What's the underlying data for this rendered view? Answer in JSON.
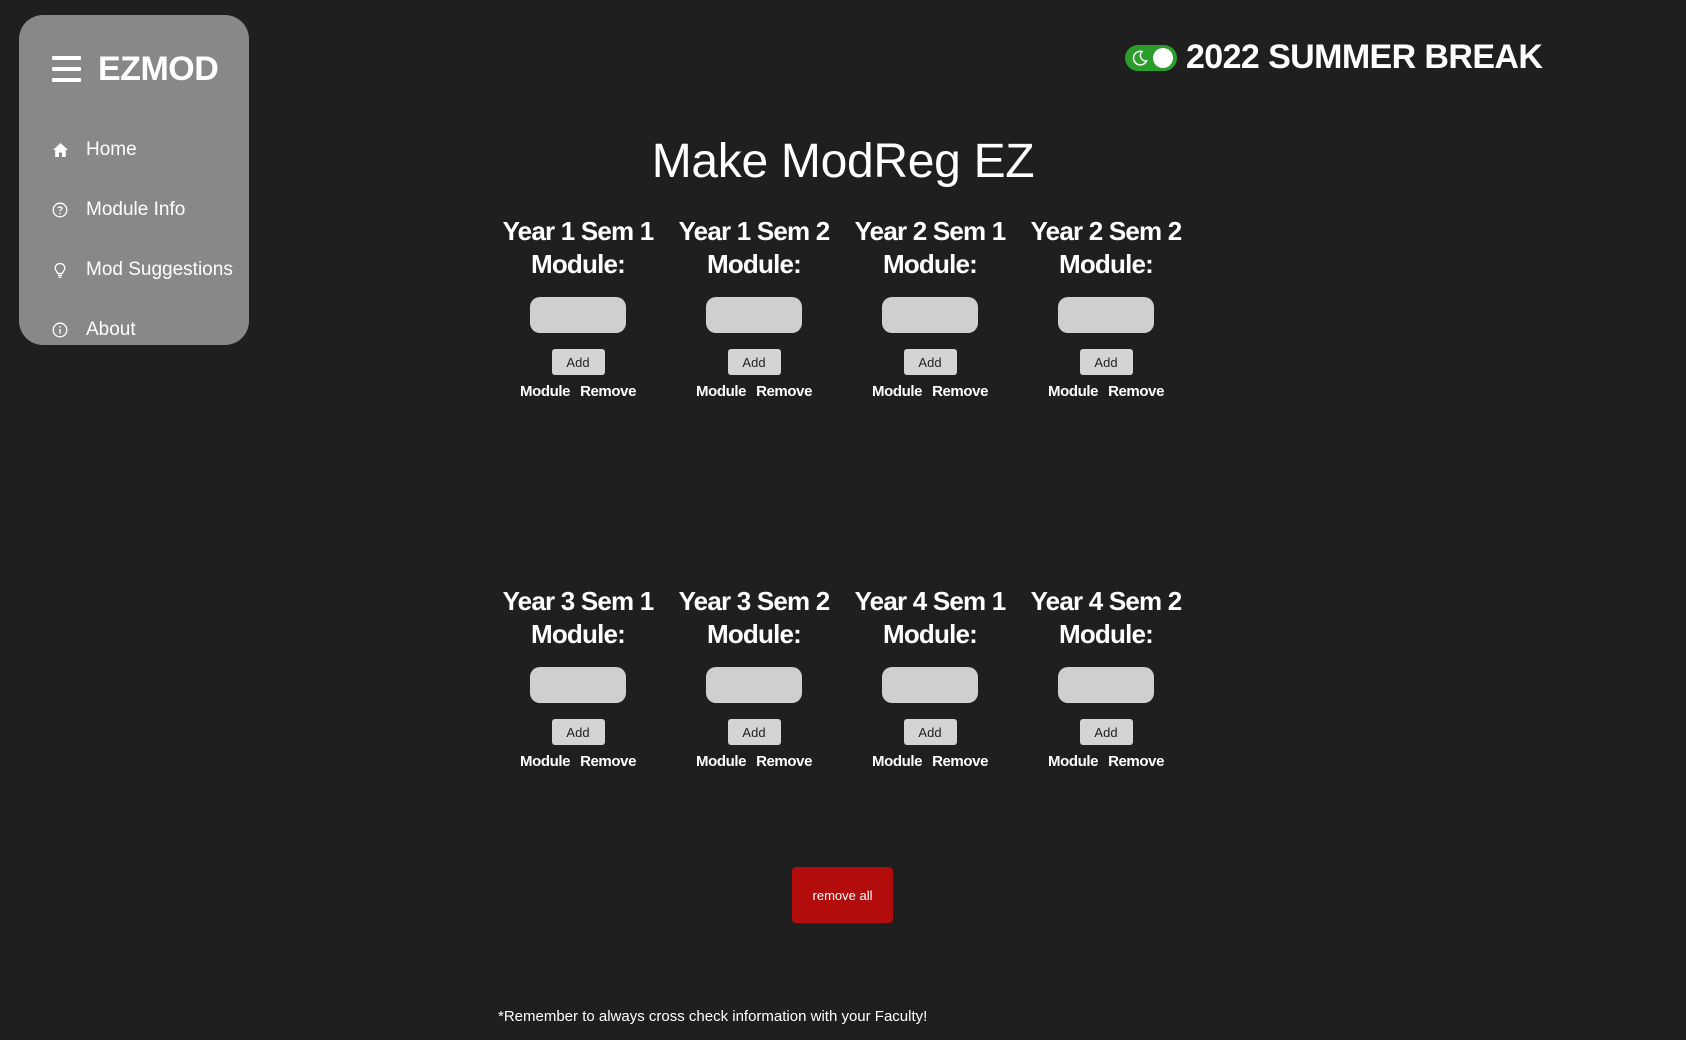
{
  "sidebar": {
    "brand": "EZMOD",
    "items": [
      {
        "label": "Home",
        "icon": "home-icon"
      },
      {
        "label": "Module Info",
        "icon": "question-circle-icon"
      },
      {
        "label": "Mod Suggestions",
        "icon": "lightbulb-icon"
      },
      {
        "label": "About",
        "icon": "info-circle-icon"
      }
    ]
  },
  "header": {
    "term": "2022 SUMMER BREAK",
    "theme_toggle": {
      "state": "dark",
      "on": true,
      "color": "#2a9d2a"
    }
  },
  "main": {
    "title": "Make ModReg EZ",
    "semesters": [
      {
        "semester": "Year 1 Sem 1",
        "module_label": "Module:",
        "input_value": "",
        "add_label": "Add",
        "col_module": "Module",
        "col_remove": "Remove"
      },
      {
        "semester": "Year 1 Sem 2",
        "module_label": "Module:",
        "input_value": "",
        "add_label": "Add",
        "col_module": "Module",
        "col_remove": "Remove"
      },
      {
        "semester": "Year 2 Sem 1",
        "module_label": "Module:",
        "input_value": "",
        "add_label": "Add",
        "col_module": "Module",
        "col_remove": "Remove"
      },
      {
        "semester": "Year 2 Sem 2",
        "module_label": "Module:",
        "input_value": "",
        "add_label": "Add",
        "col_module": "Module",
        "col_remove": "Remove"
      },
      {
        "semester": "Year 3 Sem 1",
        "module_label": "Module:",
        "input_value": "",
        "add_label": "Add",
        "col_module": "Module",
        "col_remove": "Remove"
      },
      {
        "semester": "Year 3 Sem 2",
        "module_label": "Module:",
        "input_value": "",
        "add_label": "Add",
        "col_module": "Module",
        "col_remove": "Remove"
      },
      {
        "semester": "Year 4 Sem 1",
        "module_label": "Module:",
        "input_value": "",
        "add_label": "Add",
        "col_module": "Module",
        "col_remove": "Remove"
      },
      {
        "semester": "Year 4 Sem 2",
        "module_label": "Module:",
        "input_value": "",
        "add_label": "Add",
        "col_module": "Module",
        "col_remove": "Remove"
      }
    ],
    "remove_all_label": "remove all",
    "remove_all_color": "#b30c0c",
    "footnote": "*Remember to always cross check information with your Faculty!"
  },
  "colors": {
    "background": "#1f1f1f",
    "sidebar": "#888888",
    "input": "#cfcfcf"
  }
}
